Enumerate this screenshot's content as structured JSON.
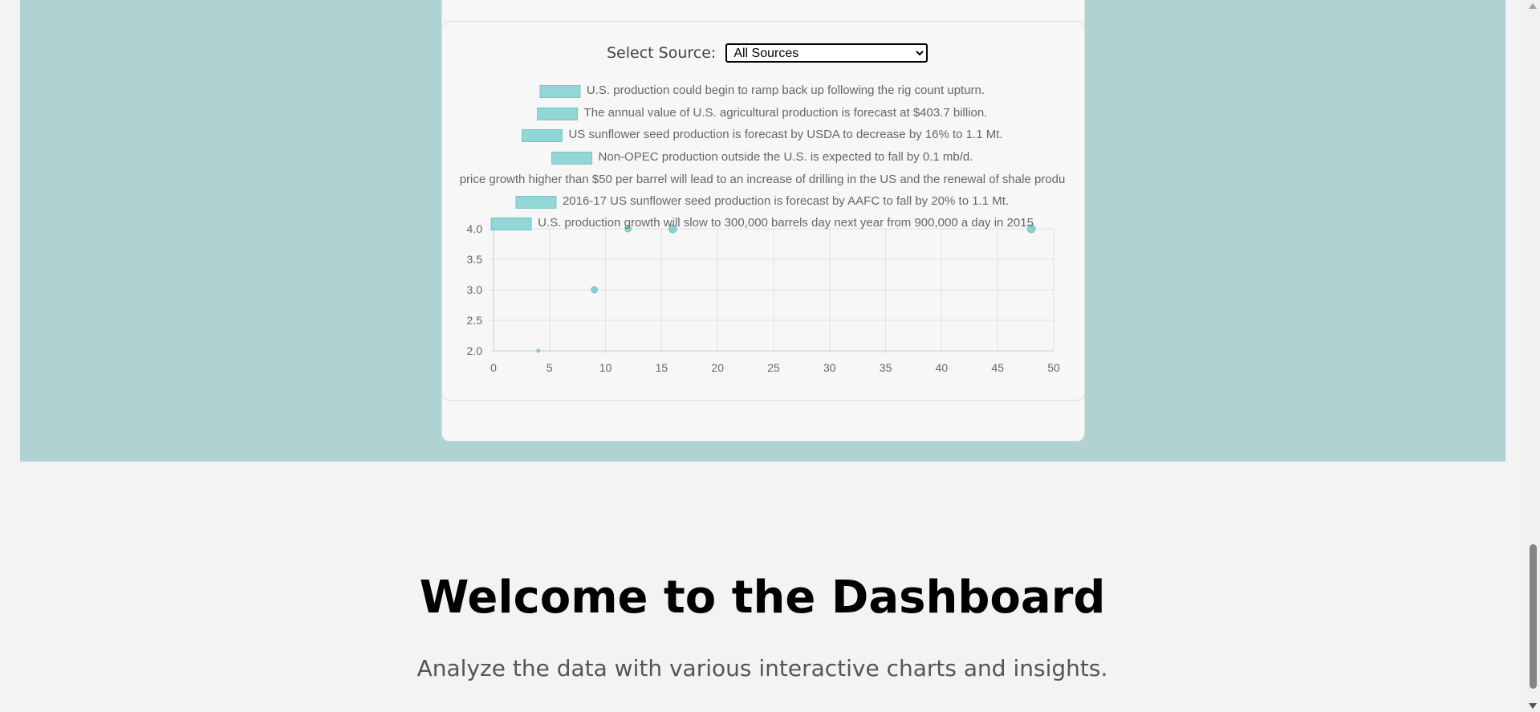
{
  "colors": {
    "teal_background": "#afd2d3",
    "card_background": "#f7f7f7",
    "bar_fill": "#92d6d6",
    "bar_stroke": "#7cc3c3",
    "point_fill": "#8ecfcf"
  },
  "source_filter": {
    "label": "Select Source:",
    "selected": "All Sources",
    "options": [
      "All Sources"
    ]
  },
  "chart_data": {
    "type": "scatter",
    "legend": [
      "U.S. production could begin to ramp back up following the rig count upturn.",
      "The annual value of U.S. agricultural production is forecast at $403.7 billion.",
      "US sunflower seed production is forecast by USDA to decrease by 16% to 1.1 Mt.",
      "Non-OPEC production outside the U.S. is expected to fall by 0.1 mb/d.",
      "price growth higher than $50 per barrel will lead to an increase of drilling in the US and the renewal of shale produ",
      "2016-17 US sunflower seed production is forecast by AAFC to fall by 20% to 1.1 Mt.",
      "U.S. production growth will slow to 300,000 barrels day next year from 900,000 a day in 2015"
    ],
    "legend_has_swatch": [
      true,
      true,
      true,
      true,
      false,
      true,
      true
    ],
    "xlim": [
      0,
      50
    ],
    "ylim": [
      2.0,
      4.0
    ],
    "x_ticks": [
      "0",
      "5",
      "10",
      "15",
      "20",
      "25",
      "30",
      "35",
      "40",
      "45",
      "50"
    ],
    "y_ticks": [
      "4.0",
      "3.5",
      "3.0",
      "2.5",
      "2.0"
    ],
    "grid": true,
    "points": [
      {
        "x": 4,
        "y": 2.0,
        "size": 2
      },
      {
        "x": 9,
        "y": 3.0,
        "size": 4
      },
      {
        "x": 12,
        "y": 4.0,
        "size": 4
      },
      {
        "x": 16,
        "y": 4.0,
        "size": 5
      },
      {
        "x": 48,
        "y": 4.0,
        "size": 5
      }
    ]
  },
  "hero": {
    "title": "Welcome to the Dashboard",
    "subtitle": "Analyze the data with various interactive charts and insights."
  }
}
